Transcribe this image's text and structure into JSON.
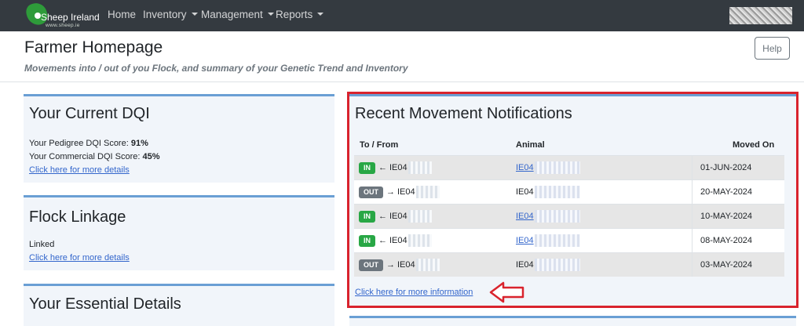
{
  "navbar": {
    "logo_text": "Sheep Ireland",
    "logo_url": "www.sheep.ie",
    "items": [
      {
        "label": "Home",
        "dropdown": false
      },
      {
        "label": "Inventory",
        "dropdown": true
      },
      {
        "label": "Management",
        "dropdown": true
      },
      {
        "label": "Reports",
        "dropdown": true
      }
    ]
  },
  "header": {
    "title": "Farmer Homepage",
    "subtitle": "Movements into / out of you Flock, and summary of your Genetic Trend and Inventory",
    "help_label": "Help"
  },
  "dqi_card": {
    "title": "Your Current DQI",
    "pedigree_label": "Your Pedigree DQI Score: ",
    "pedigree_value": "91%",
    "commercial_label": "Your Commercial DQI Score: ",
    "commercial_value": "45%",
    "link": "Click here for more details"
  },
  "linkage_card": {
    "title": "Flock Linkage",
    "status": "Linked",
    "link": "Click here for more details"
  },
  "essential_card": {
    "title": "Your Essential Details"
  },
  "movements": {
    "title": "Recent Movement Notifications",
    "columns": [
      "To / From",
      "Animal",
      "Moved On"
    ],
    "rows": [
      {
        "direction": "IN",
        "arrow": "←",
        "herd": "IE04",
        "animal": "IE04",
        "animal_link": true,
        "date": "01-JUN-2024"
      },
      {
        "direction": "OUT",
        "arrow": "→",
        "herd": "IE04",
        "animal": "IE04",
        "animal_link": false,
        "date": "20-MAY-2024"
      },
      {
        "direction": "IN",
        "arrow": "←",
        "herd": "IE04",
        "animal": "IE04",
        "animal_link": true,
        "date": "10-MAY-2024"
      },
      {
        "direction": "IN",
        "arrow": "←",
        "herd": "IE04",
        "animal": "IE04",
        "animal_link": true,
        "date": "08-MAY-2024"
      },
      {
        "direction": "OUT",
        "arrow": "→",
        "herd": "IE04",
        "animal": "IE04",
        "animal_link": false,
        "date": "03-MAY-2024"
      }
    ],
    "more_link": "Click here for more information"
  },
  "colors": {
    "navbar": "#343a40",
    "card_bg": "#f1f5fa",
    "card_accent": "#6a9fd4",
    "badge_in": "#28a745",
    "badge_out": "#6c757d",
    "highlight": "#d9232d",
    "link": "#3366cc"
  },
  "icons": {
    "logo": "sheep-ireland-logo",
    "pointer": "left-arrow-icon"
  }
}
